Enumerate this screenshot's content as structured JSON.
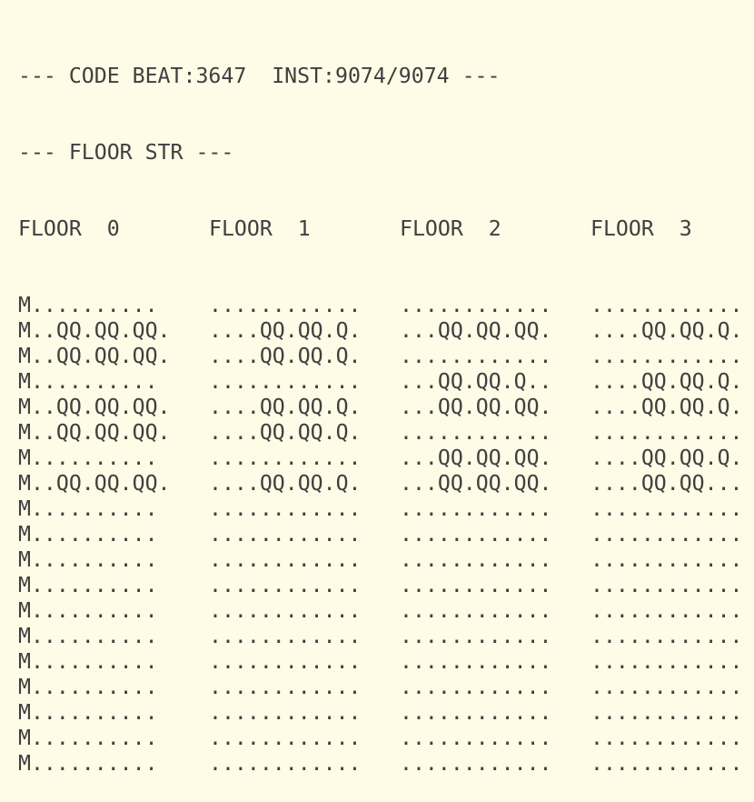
{
  "header": {
    "line1": "--- CODE BEAT:3647  INST:9074/9074 ---",
    "line2": "--- FLOOR STR ---"
  },
  "floor_labels": [
    "FLOOR  0",
    "FLOOR  1",
    "FLOOR  2",
    "FLOOR  3"
  ],
  "rows": [
    [
      "M..........",
      "............",
      "............",
      "............"
    ],
    [
      "M..QQ.QQ.QQ.",
      "....QQ.QQ.Q.",
      "...QQ.QQ.QQ.",
      "....QQ.QQ.Q."
    ],
    [
      "M..QQ.QQ.QQ.",
      "....QQ.QQ.Q.",
      "............",
      "............"
    ],
    [
      "M..........",
      "............",
      "...QQ.QQ.Q..",
      "....QQ.QQ.Q."
    ],
    [
      "M..QQ.QQ.QQ.",
      "....QQ.QQ.Q.",
      "...QQ.QQ.QQ.",
      "....QQ.QQ.Q."
    ],
    [
      "M..QQ.QQ.QQ.",
      "....QQ.QQ.Q.",
      "............",
      "............"
    ],
    [
      "M..........",
      "............",
      "...QQ.QQ.QQ.",
      "....QQ.QQ.Q."
    ],
    [
      "M..QQ.QQ.QQ.",
      "....QQ.QQ.Q.",
      "...QQ.QQ.QQ.",
      "....QQ.QQ..."
    ],
    [
      "M..........",
      "............",
      "............",
      "............"
    ],
    [
      "M..........",
      "............",
      "............",
      "............"
    ],
    [
      "M..........",
      "............",
      "............",
      "............"
    ],
    [
      "M..........",
      "............",
      "............",
      "............"
    ],
    [
      "M..........",
      "............",
      "............",
      "............"
    ],
    [
      "M..........",
      "............",
      "............",
      "............"
    ],
    [
      "M..........",
      "............",
      "............",
      "............"
    ],
    [
      "M..........",
      "............",
      "............",
      "............"
    ],
    [
      "M..........",
      "............",
      "............",
      "............"
    ],
    [
      "M..........",
      "............",
      "............",
      "............"
    ],
    [
      "M..........",
      "............",
      "............",
      "............"
    ]
  ]
}
